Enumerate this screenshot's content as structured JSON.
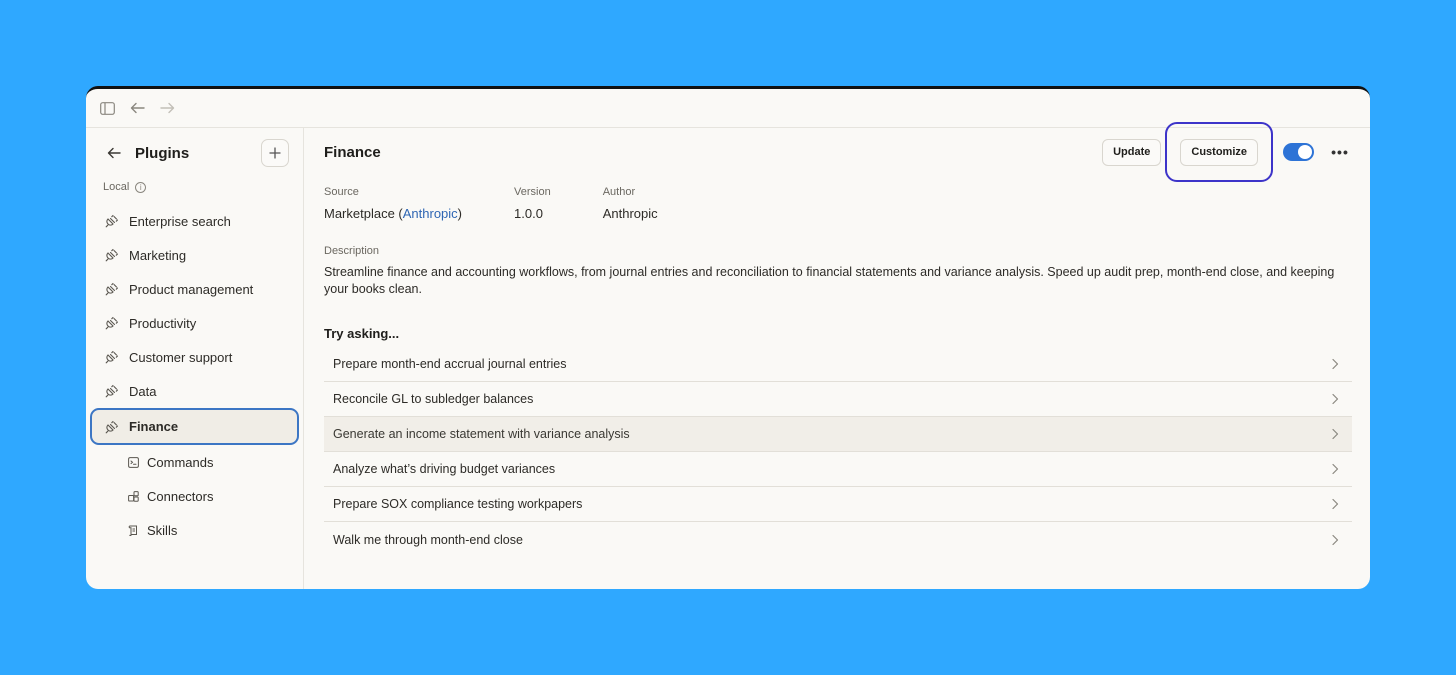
{
  "sidebar": {
    "title": "Plugins",
    "section_label": "Local",
    "items": [
      {
        "label": "Enterprise search"
      },
      {
        "label": "Marketing"
      },
      {
        "label": "Product management"
      },
      {
        "label": "Productivity"
      },
      {
        "label": "Customer support"
      },
      {
        "label": "Data"
      },
      {
        "label": "Finance"
      }
    ],
    "sub_items": [
      {
        "label": "Commands"
      },
      {
        "label": "Connectors"
      },
      {
        "label": "Skills"
      }
    ]
  },
  "main": {
    "title": "Finance",
    "update_label": "Update",
    "customize_label": "Customize",
    "source_label": "Source",
    "source_prefix": "Marketplace (",
    "source_link": "Anthropic",
    "source_suffix": ")",
    "version_label": "Version",
    "version_value": "1.0.0",
    "author_label": "Author",
    "author_value": "Anthropic",
    "description_label": "Description",
    "description": "Streamline finance and accounting workflows, from journal entries and reconciliation to financial statements and variance analysis. Speed up audit prep, month-end close, and keeping your books clean.",
    "try_label": "Try asking...",
    "prompts": [
      {
        "label": "Prepare month-end accrual journal entries"
      },
      {
        "label": "Reconcile GL to subledger balances"
      },
      {
        "label": "Generate an income statement with variance analysis"
      },
      {
        "label": "Analyze what’s driving budget variances"
      },
      {
        "label": "Prepare SOX compliance testing workpapers"
      },
      {
        "label": "Walk me through month-end close"
      }
    ]
  },
  "colors": {
    "background": "#2fa8ff",
    "accent": "#2d73d6",
    "highlight_ring": "#3d34c9",
    "active_border": "#3c76c4"
  }
}
